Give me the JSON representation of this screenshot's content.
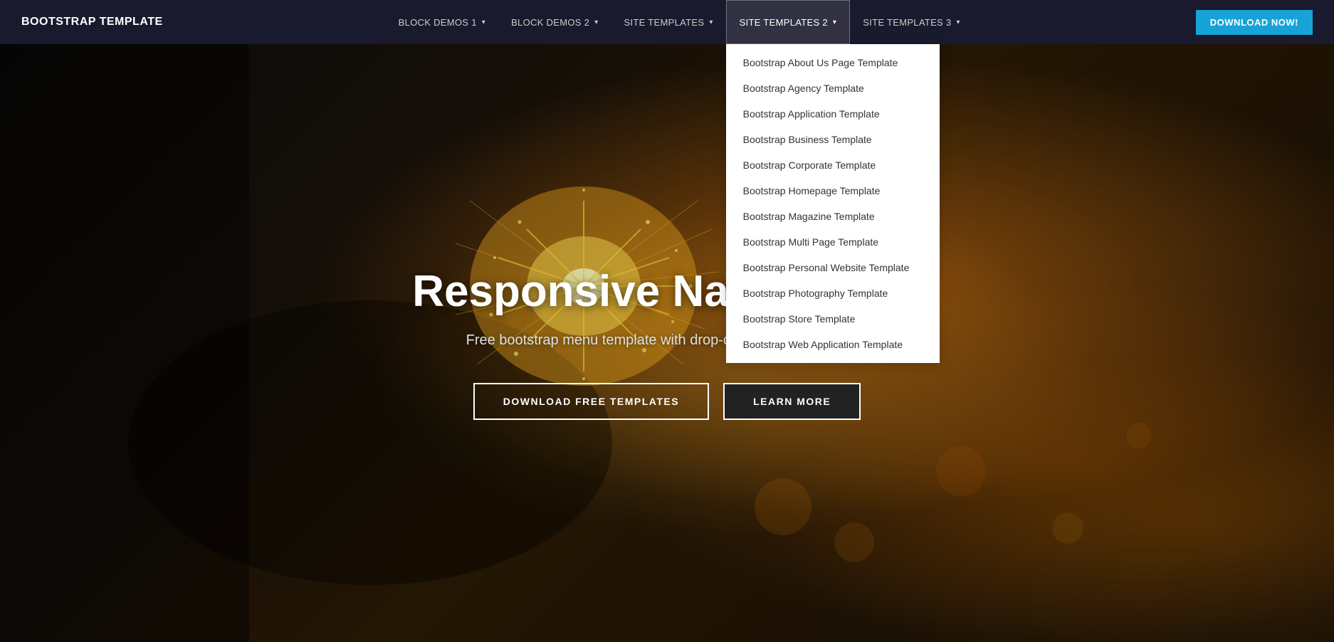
{
  "navbar": {
    "brand": "BOOTSTRAP TEMPLATE",
    "nav_items": [
      {
        "id": "block-demos-1",
        "label": "BLOCK DEMOS 1",
        "has_caret": true,
        "active": false
      },
      {
        "id": "block-demos-2",
        "label": "BLOCK DEMOS 2",
        "has_caret": true,
        "active": false
      },
      {
        "id": "site-templates",
        "label": "SITE TEMPLATES",
        "has_caret": true,
        "active": false
      },
      {
        "id": "site-templates-2",
        "label": "SITE TEMPLATES 2",
        "has_caret": true,
        "active": true
      },
      {
        "id": "site-templates-3",
        "label": "SITE TEMPLATES 3",
        "has_caret": true,
        "active": false
      }
    ],
    "download_btn": "DOWNLOAD NOW!",
    "dropdown": {
      "open_for": "site-templates-2",
      "items": [
        "Bootstrap About Us Page Template",
        "Bootstrap Agency Template",
        "Bootstrap Application Template",
        "Bootstrap Business Template",
        "Bootstrap Corporate Template",
        "Bootstrap Homepage Template",
        "Bootstrap Magazine Template",
        "Bootstrap Multi Page Template",
        "Bootstrap Personal Website Template",
        "Bootstrap Photography Template",
        "Bootstrap Store Template",
        "Bootstrap Web Application Template"
      ]
    }
  },
  "hero": {
    "title": "Responsive Navbar Tem",
    "subtitle": "Free bootstrap menu template with drop-down lists and buttons.",
    "btn_download": "DOWNLOAD FREE TEMPLATES",
    "btn_learn": "LEARN MORE"
  }
}
